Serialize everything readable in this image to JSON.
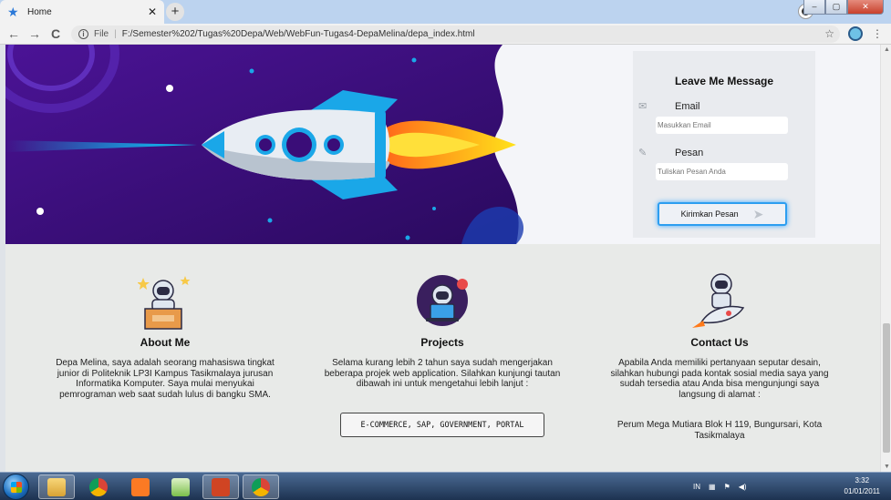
{
  "browser": {
    "tab_title": "Home",
    "tab_close": "✕",
    "new_tab": "+",
    "url_scheme": "File",
    "url_separator": "|",
    "url": "F:/Semester%202/Tugas%20Depa/Web/WebFun-Tugas4-DepaMelina/depa_index.html",
    "nav_back": "←",
    "nav_forward": "→",
    "nav_reload": "C",
    "info_icon": "i",
    "bookmark_icon": "☆",
    "menu_icon": "⋮",
    "win_controls": {
      "minimize": "–",
      "maximize": "▢",
      "close": "✕"
    }
  },
  "message_form": {
    "title": "Leave Me Message",
    "email_label": "Email",
    "email_icon": "✉",
    "email_placeholder": "Masukkan Email",
    "message_label": "Pesan",
    "message_icon": "✎",
    "message_placeholder": "Tuliskan Pesan Anda",
    "submit_label": "Kirimkan Pesan",
    "submit_icon": "➤"
  },
  "sections": {
    "about": {
      "title": "About Me",
      "text": "Depa Melina, saya adalah seorang mahasiswa tingkat junior di Politeknik LP3I Kampus Tasikmalaya jurusan Informatika Komputer. Saya mulai menyukai pemrograman web saat sudah lulus di bangku SMA."
    },
    "projects": {
      "title": "Projects",
      "text": "Selama kurang lebih 2 tahun saya sudah mengerjakan beberapa projek web application. Silahkan kunjungi tautan dibawah ini untuk mengetahui lebih lanjut :",
      "chip": "E-COMMERCE, SAP, GOVERNMENT, PORTAL"
    },
    "contact": {
      "title": "Contact Us",
      "text": "Apabila Anda memiliki pertanyaan seputar desain, silahkan hubungi pada kontak sosial media saya yang sudah tersedia atau Anda bisa mengunjungi saya langsung di alamat :",
      "address": "Perum Mega Mutiara Blok H 119, Bungursari, Kota Tasikmalaya"
    }
  },
  "taskbar": {
    "tray_lang": "IN",
    "time": "3:32",
    "date": "01/01/2011"
  },
  "colors": {
    "hero_purple": "#3a0d78",
    "accent_blue": "#2d9ef0",
    "flame_orange": "#ff7a1a",
    "flame_yellow": "#ffd200"
  }
}
